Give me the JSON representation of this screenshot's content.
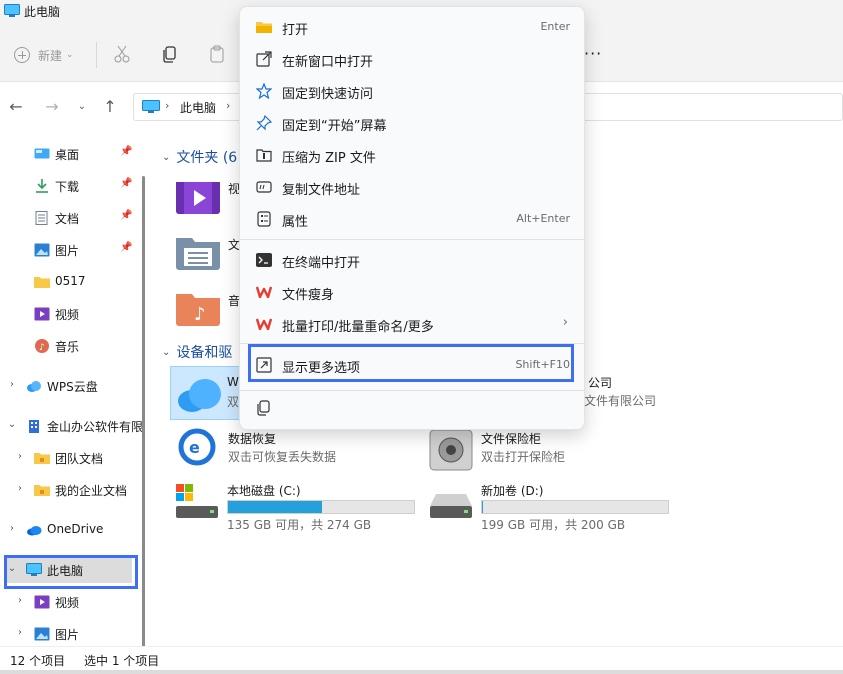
{
  "window": {
    "title": "此电脑"
  },
  "toolbar": {
    "new_label": "新建",
    "more_label": "···"
  },
  "address": {
    "location": "此电脑"
  },
  "sidebar": {
    "items": [
      {
        "label": "桌面"
      },
      {
        "label": "下载"
      },
      {
        "label": "文档"
      },
      {
        "label": "图片"
      },
      {
        "label": "0517"
      },
      {
        "label": "视频"
      },
      {
        "label": "音乐"
      },
      {
        "label": "WPS云盘"
      },
      {
        "label": "金山办公软件有限"
      },
      {
        "label": "团队文档"
      },
      {
        "label": "我的企业文档"
      },
      {
        "label": "OneDrive"
      },
      {
        "label": "此电脑"
      },
      {
        "label": "视频"
      },
      {
        "label": "图片"
      }
    ]
  },
  "main": {
    "folders_header": "文件夹 (6",
    "folders": [
      {
        "name": "视"
      },
      {
        "name": "文"
      },
      {
        "name": "音"
      }
    ],
    "devices_header": "设备和驱",
    "devices": [
      {
        "name": "W",
        "sub": "双"
      },
      {
        "name": "公司",
        "sub": "文件有限公司"
      },
      {
        "name": "数据恢复",
        "sub": "双击可恢复丢失数据"
      },
      {
        "name": "文件保险柜",
        "sub": "双击打开保险柜"
      }
    ],
    "drives": [
      {
        "name": "本地磁盘 (C:)",
        "sub": "135 GB 可用，共 274 GB",
        "used_fraction": 0.507
      },
      {
        "name": "新加卷 (D:)",
        "sub": "199 GB 可用，共 200 GB",
        "used_fraction": 0.005
      }
    ]
  },
  "context_menu": {
    "items": [
      {
        "label": "打开",
        "shortcut": "Enter"
      },
      {
        "label": "在新窗口中打开",
        "shortcut": ""
      },
      {
        "label": "固定到快速访问",
        "shortcut": ""
      },
      {
        "label": "固定到“开始”屏幕",
        "shortcut": ""
      },
      {
        "label": "压缩为 ZIP 文件",
        "shortcut": ""
      },
      {
        "label": "复制文件地址",
        "shortcut": ""
      },
      {
        "label": "属性",
        "shortcut": "Alt+Enter"
      },
      {
        "label": "在终端中打开",
        "shortcut": ""
      },
      {
        "label": "文件瘦身",
        "shortcut": ""
      },
      {
        "label": "批量打印/批量重命名/更多",
        "shortcut": ""
      },
      {
        "label": "显示更多选项",
        "shortcut": "Shift+F10"
      }
    ]
  },
  "status": {
    "item_count": "12 个项目",
    "selected": "选中 1 个项目"
  },
  "colors": {
    "accent": "#3c6ff2",
    "drive_fill": "#26a0da",
    "header_blue": "#1a4fa0"
  }
}
